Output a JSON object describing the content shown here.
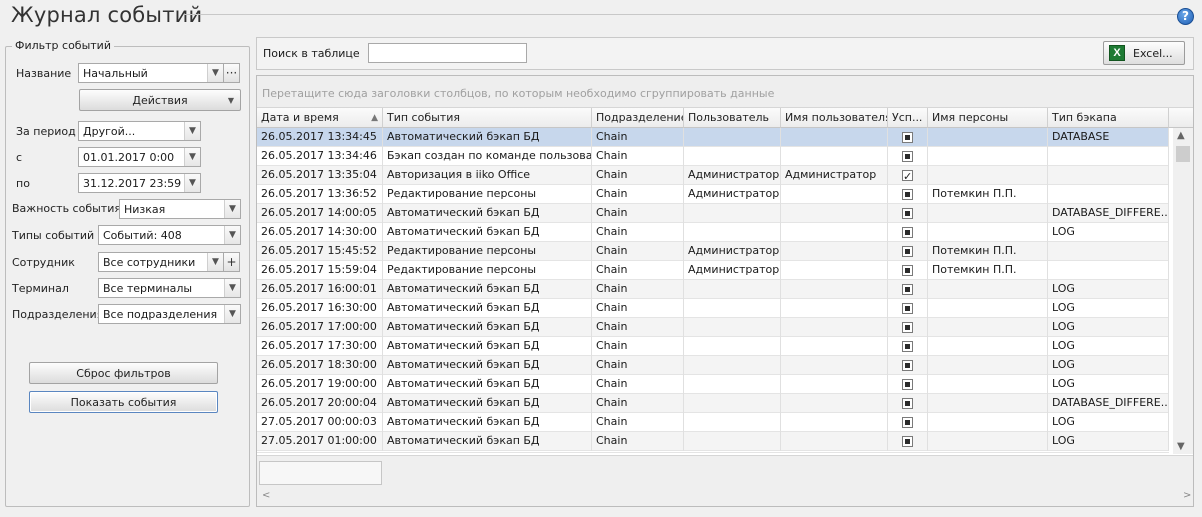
{
  "window": {
    "title": "Журнал событий",
    "help": "?"
  },
  "filter": {
    "legend": "Фильтр событий",
    "name_label": "Название",
    "name_value": "Начальный",
    "more": "···",
    "actions_label": "Действия",
    "period_label": "За период",
    "period_value": "Другой...",
    "from_label": "с",
    "from_value": "01.01.2017 0:00",
    "to_label": "по",
    "to_value": "31.12.2017 23:59",
    "importance_label": "Важность события",
    "importance_value": "Низкая",
    "types_label": "Типы событий",
    "types_value": "Событий: 408",
    "employee_label": "Сотрудник",
    "employee_value": "Все сотрудники",
    "add": "+",
    "terminal_label": "Терминал",
    "terminal_value": "Все терминалы",
    "division_label": "Подразделения",
    "division_value": "Все подразделения",
    "reset_label": "Сброс фильтров",
    "show_label": "Показать события"
  },
  "search": {
    "label": "Поиск в таблице",
    "value": "",
    "excel_label": "Excel..."
  },
  "grid": {
    "group_hint": "Перетащите сюда заголовки столбцов, по которым необходимо сгруппировать данные",
    "columns": [
      "Дата и время",
      "Тип события",
      "Подразделение",
      "Пользователь",
      "Имя пользователя",
      "Усп...",
      "Имя персоны",
      "Тип бэкапа"
    ],
    "rows": [
      [
        "26.05.2017 13:34:45",
        "Автоматический бэкап БД",
        "Chain",
        "",
        "",
        "fill",
        "",
        "DATABASE"
      ],
      [
        "26.05.2017 13:34:46",
        "Бэкап создан по команде пользоват...",
        "Chain",
        "",
        "",
        "fill",
        "",
        ""
      ],
      [
        "26.05.2017 13:35:04",
        "Авторизация в iiko Office",
        "Chain",
        "Администратор",
        "Администратор",
        "tick",
        "",
        ""
      ],
      [
        "26.05.2017 13:36:52",
        "Редактирование персоны",
        "Chain",
        "Администратор",
        "",
        "fill",
        "Потемкин П.П.",
        ""
      ],
      [
        "26.05.2017 14:00:05",
        "Автоматический бэкап БД",
        "Chain",
        "",
        "",
        "fill",
        "",
        "DATABASE_DIFFERE..."
      ],
      [
        "26.05.2017 14:30:00",
        "Автоматический бэкап БД",
        "Chain",
        "",
        "",
        "fill",
        "",
        "LOG"
      ],
      [
        "26.05.2017 15:45:52",
        "Редактирование персоны",
        "Chain",
        "Администратор",
        "",
        "fill",
        "Потемкин П.П.",
        ""
      ],
      [
        "26.05.2017 15:59:04",
        "Редактирование персоны",
        "Chain",
        "Администратор",
        "",
        "fill",
        "Потемкин П.П.",
        ""
      ],
      [
        "26.05.2017 16:00:01",
        "Автоматический бэкап БД",
        "Chain",
        "",
        "",
        "fill",
        "",
        "LOG"
      ],
      [
        "26.05.2017 16:30:00",
        "Автоматический бэкап БД",
        "Chain",
        "",
        "",
        "fill",
        "",
        "LOG"
      ],
      [
        "26.05.2017 17:00:00",
        "Автоматический бэкап БД",
        "Chain",
        "",
        "",
        "fill",
        "",
        "LOG"
      ],
      [
        "26.05.2017 17:30:00",
        "Автоматический бэкап БД",
        "Chain",
        "",
        "",
        "fill",
        "",
        "LOG"
      ],
      [
        "26.05.2017 18:30:00",
        "Автоматический бэкап БД",
        "Chain",
        "",
        "",
        "fill",
        "",
        "LOG"
      ],
      [
        "26.05.2017 19:00:00",
        "Автоматический бэкап БД",
        "Chain",
        "",
        "",
        "fill",
        "",
        "LOG"
      ],
      [
        "26.05.2017 20:00:04",
        "Автоматический бэкап БД",
        "Chain",
        "",
        "",
        "fill",
        "",
        "DATABASE_DIFFERE..."
      ],
      [
        "27.05.2017 00:00:03",
        "Автоматический бэкап БД",
        "Chain",
        "",
        "",
        "fill",
        "",
        "LOG"
      ],
      [
        "27.05.2017 01:00:00",
        "Автоматический бэкап БД",
        "Chain",
        "",
        "",
        "fill",
        "",
        "LOG"
      ]
    ]
  },
  "icons": {
    "excel": "excel-icon",
    "help": "help-icon",
    "dropdown": "chevron-down-icon",
    "sort": "sort-asc-icon"
  }
}
